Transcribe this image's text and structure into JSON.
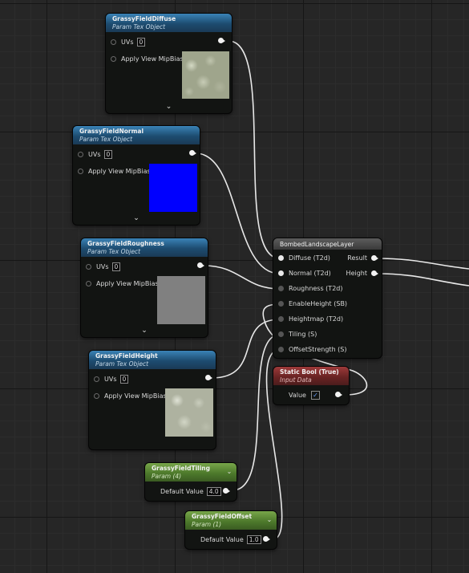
{
  "nodes": {
    "diffuse": {
      "title": "GrassyFieldDiffuse",
      "subtitle": "Param Tex Object",
      "uvs_label": "UVs",
      "uvs_value": "0",
      "mip_label": "Apply View MipBias"
    },
    "normal": {
      "title": "GrassyFieldNormal",
      "subtitle": "Param Tex Object",
      "uvs_label": "UVs",
      "uvs_value": "0",
      "mip_label": "Apply View MipBias"
    },
    "roughness": {
      "title": "GrassyFieldRoughness",
      "subtitle": "Param Tex Object",
      "uvs_label": "UVs",
      "uvs_value": "0",
      "mip_label": "Apply View MipBias"
    },
    "height": {
      "title": "GrassyFieldHeight",
      "subtitle": "Param Tex Object",
      "uvs_label": "UVs",
      "uvs_value": "0",
      "mip_label": "Apply View MipBias"
    },
    "layer": {
      "title": "BombedLandscapeLayer",
      "inputs": [
        "Diffuse (T2d)",
        "Normal (T2d)",
        "Roughness (T2d)",
        "EnableHeight (SB)",
        "Heightmap (T2d)",
        "Tiling (S)",
        "OffsetStrength (S)"
      ],
      "outputs": [
        "Result",
        "Height"
      ]
    },
    "static_bool": {
      "title": "Static Bool (True)",
      "subtitle": "Input Data",
      "value_label": "Value",
      "checked": true
    },
    "tiling": {
      "title": "GrassyFieldTiling",
      "subtitle": "Param (4)",
      "value_label": "Default Value",
      "value": "4.0"
    },
    "offset": {
      "title": "GrassyFieldOffset",
      "subtitle": "Param (1)",
      "value_label": "Default Value",
      "value": "1.0"
    }
  },
  "colors": {
    "texture_header": "#2a6894",
    "bool_header": "#7a2a2a",
    "param_header": "#5a8a36",
    "normal_map_preview": "#0000ff",
    "roughness_preview": "#808080",
    "checkbox_tick": "#6aa0ff"
  },
  "icons": {
    "checkmark": "✓",
    "chevron": "⌄"
  }
}
